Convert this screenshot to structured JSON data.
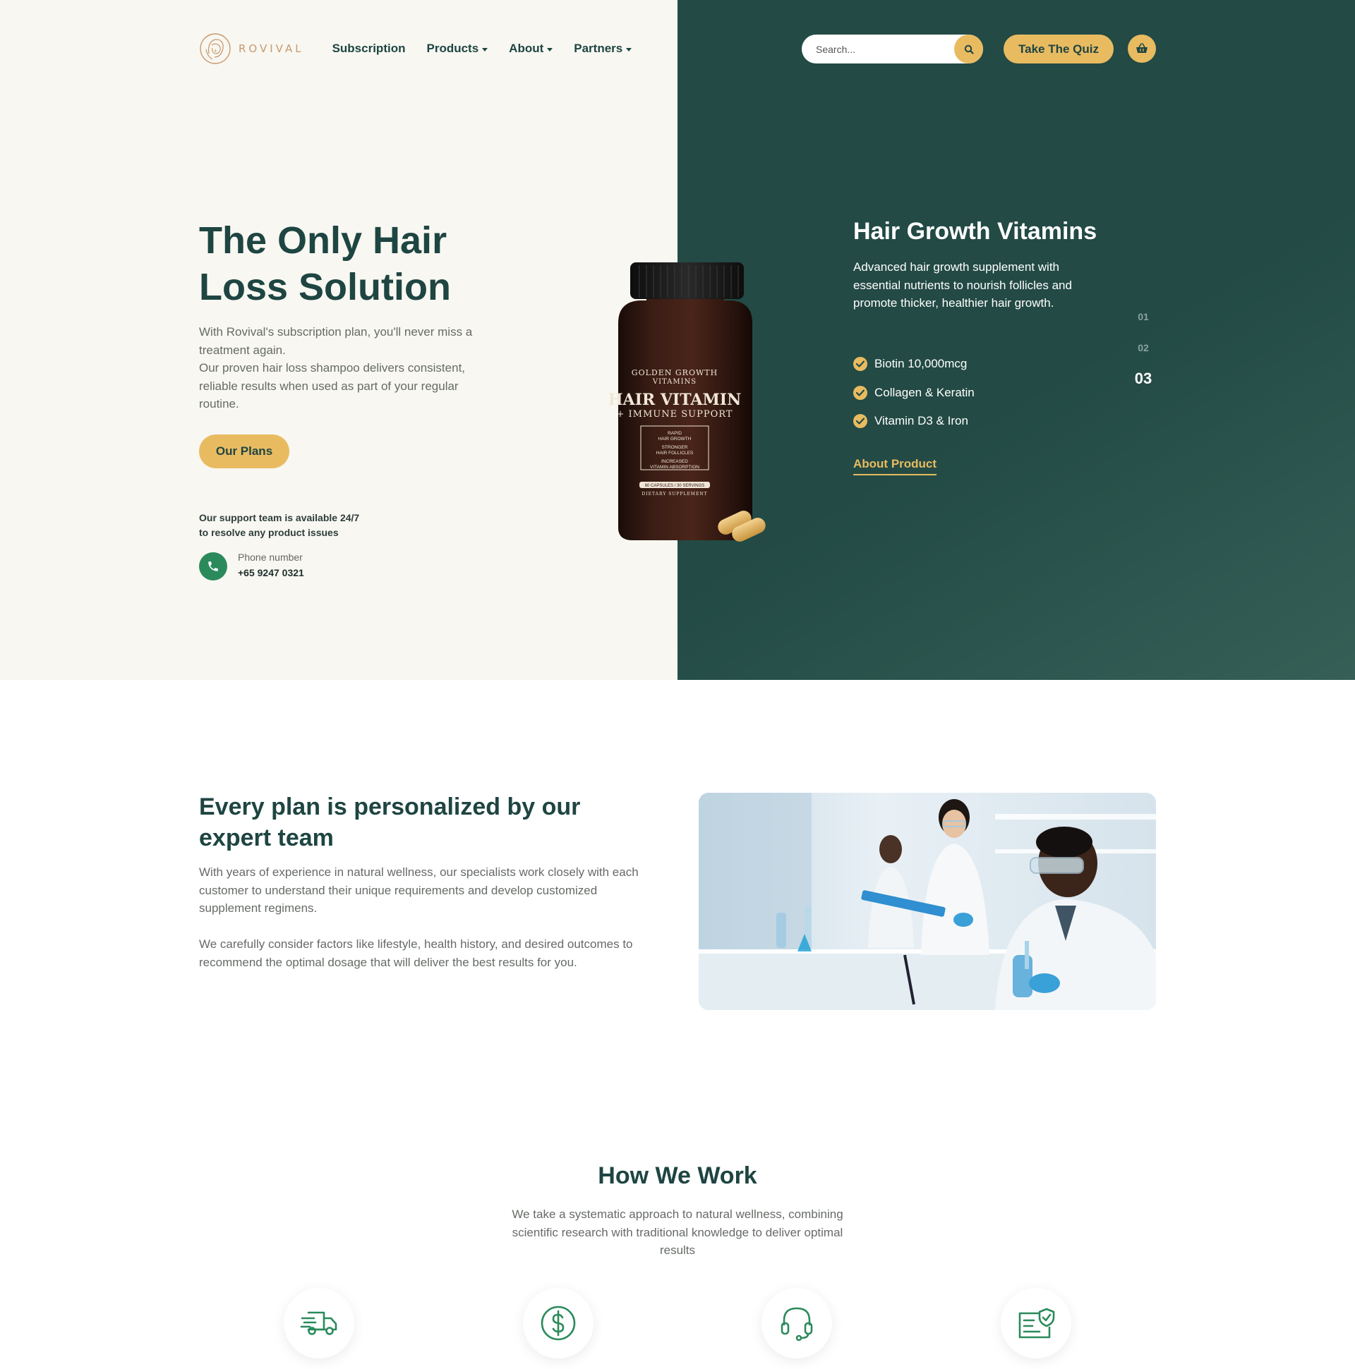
{
  "header": {
    "brand": "ROVIVAL",
    "menu": [
      {
        "label": "Subscription",
        "dropdown": false
      },
      {
        "label": "Products",
        "dropdown": true
      },
      {
        "label": "About",
        "dropdown": true
      },
      {
        "label": "Partners",
        "dropdown": true
      }
    ],
    "search_placeholder": "Search...",
    "quiz_label": "Take The Quiz"
  },
  "hero": {
    "title": "The Only Hair Loss Solution",
    "description_1": "With Rovival's subscription plan, you'll never miss a treatment again.",
    "description_2": "Our proven hair loss shampoo delivers consistent, reliable results when used as part of your regular routine.",
    "plans_label": "Our Plans",
    "support_line_1": "Our support team is available 24/7",
    "support_line_2": "to resolve any product issues",
    "phone_label": "Phone number",
    "phone_number": "+65 9247 0321"
  },
  "bottle_label": {
    "brand_line_1": "GOLDEN GROWTH",
    "brand_line_2": "VITAMINS",
    "name": "HAIR VITAMIN",
    "sub": "+ IMMUNE SUPPORT",
    "claim_1a": "RAPID",
    "claim_1b": "HAIR GROWTH",
    "claim_2a": "STRONGER",
    "claim_2b": "HAIR FOLLICLES",
    "claim_3a": "INCREASED",
    "claim_3b": "VITAMIN ABSORPTION",
    "count": "60 CAPSULES / 30 SERVINGS",
    "type": "DIETARY SUPPLEMENT"
  },
  "product": {
    "title": "Hair Growth Vitamins",
    "description": "Advanced hair growth supplement with essential nutrients to nourish follicles and promote thicker, healthier hair growth.",
    "features": [
      "Biotin 10,000mcg",
      "Collagen & Keratin",
      "Vitamin D3 & Iron"
    ],
    "link_label": "About Product",
    "slides": [
      "01",
      "02",
      "03"
    ],
    "active_slide": "03"
  },
  "team": {
    "title": "Every plan is personalized by our expert team",
    "paragraph_1": "With years of experience in natural wellness, our specialists work closely with each customer to understand their unique requirements and develop customized supplement regimens.",
    "paragraph_2": "We carefully consider factors like lifestyle, health history, and desired outcomes to recommend the optimal dosage that will deliver the best results for you."
  },
  "how_we_work": {
    "title": "How We Work",
    "description": "We take a systematic approach to natural wellness, combining scientific research with traditional knowledge to deliver optimal results",
    "icons": [
      "delivery-truck-icon",
      "dollar-coin-icon",
      "headset-icon",
      "verified-document-icon"
    ]
  },
  "colors": {
    "dark_green": "#234a44",
    "accent_gold": "#e9bb61",
    "cream": "#f8f7f2",
    "icon_green": "#2b8a5b",
    "logo_tan": "#c99a6e"
  }
}
